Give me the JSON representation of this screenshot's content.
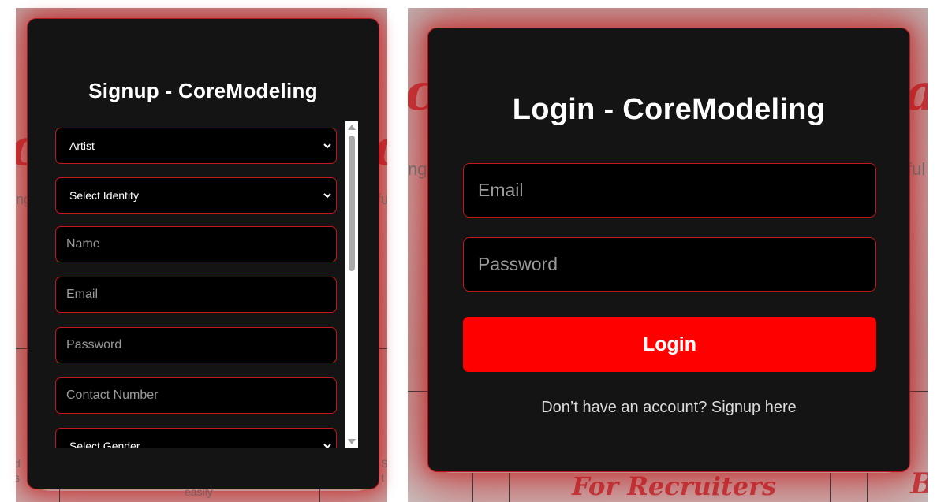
{
  "signup": {
    "title": "Signup - CoreModeling",
    "role_value": "Artist",
    "identity_value": "Select Identity",
    "name_placeholder": "Name",
    "email_placeholder": "Email",
    "password_placeholder": "Password",
    "contact_placeholder": "Contact Number",
    "gender_value": "Select Gender"
  },
  "login": {
    "title": "Login - CoreModeling",
    "email_placeholder": "Email",
    "password_placeholder": "Password",
    "button_label": "Login",
    "signup_link": "Don’t have an account? Signup here"
  },
  "background": {
    "left_fragments": [
      "ng",
      "fu",
      "d",
      "s",
      "S",
      "t",
      "easily"
    ],
    "right_fragments": [
      "ng",
      "ful",
      "For Recruiters"
    ]
  },
  "colors": {
    "accent": "#ff0000",
    "border": "#c2181d",
    "modal_bg": "#141414"
  }
}
